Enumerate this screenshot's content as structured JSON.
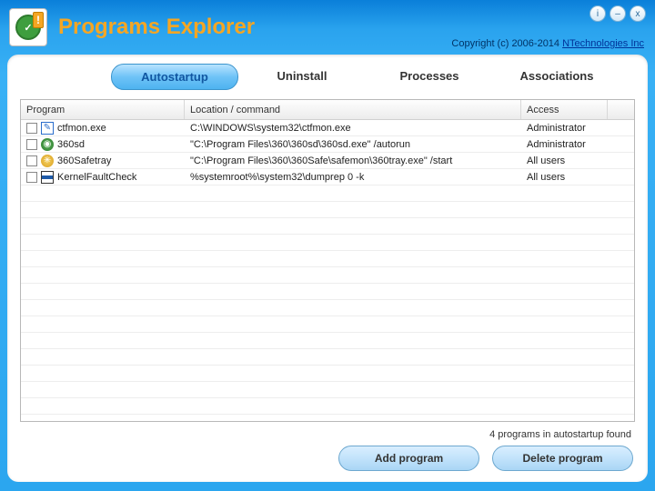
{
  "app": {
    "title": "Programs Explorer",
    "copyright_prefix": "Copyright (c) 2006-2014  ",
    "copyright_link": "NTechnologies Inc"
  },
  "window_controls": {
    "info": "i",
    "minimize": "–",
    "close": "x"
  },
  "tabs": {
    "autostartup": "Autostartup",
    "uninstall": "Uninstall",
    "processes": "Processes",
    "associations": "Associations"
  },
  "columns": {
    "program": "Program",
    "location": "Location / command",
    "access": "Access"
  },
  "rows": [
    {
      "icon": "ctfmon",
      "program": "ctfmon.exe",
      "location": "C:\\WINDOWS\\system32\\ctfmon.exe",
      "access": "Administrator"
    },
    {
      "icon": "360sd",
      "program": "360sd",
      "location": "\"C:\\Program Files\\360\\360sd\\360sd.exe\" /autorun",
      "access": "Administrator"
    },
    {
      "icon": "360safe",
      "program": "360Safetray",
      "location": "\"C:\\Program Files\\360\\360Safe\\safemon\\360tray.exe\" /start",
      "access": "All users"
    },
    {
      "icon": "kernel",
      "program": "KernelFaultCheck",
      "location": "%systemroot%\\system32\\dumprep 0 -k",
      "access": "All users"
    }
  ],
  "status": "4 programs in autostartup found",
  "buttons": {
    "add": "Add program",
    "delete": "Delete program"
  }
}
